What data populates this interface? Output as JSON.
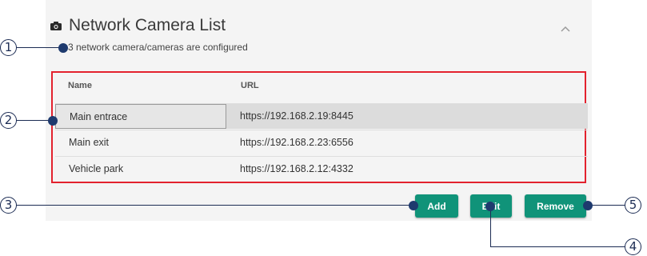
{
  "panel": {
    "title": "Network Camera List",
    "subtitle": "3 network camera/cameras are configured",
    "camera_icon": "camera-icon",
    "collapse_icon": "chevron-up-icon"
  },
  "table": {
    "headers": [
      "Name",
      "URL"
    ],
    "rows": [
      {
        "name": "Main entrace",
        "url": "https://192.168.2.19:8445",
        "selected": true
      },
      {
        "name": "Main exit",
        "url": "https://192.168.2.23:6556",
        "selected": false
      },
      {
        "name": "Vehicle park",
        "url": "https://192.168.2.12:4332",
        "selected": false
      }
    ]
  },
  "buttons": {
    "add": "Add",
    "edit": "Edit",
    "remove": "Remove"
  },
  "callouts": [
    "1",
    "2",
    "3",
    "4",
    "5"
  ],
  "colors": {
    "accent": "#109379",
    "highlight_border": "#e3222e",
    "callout": "#1c2c54"
  }
}
